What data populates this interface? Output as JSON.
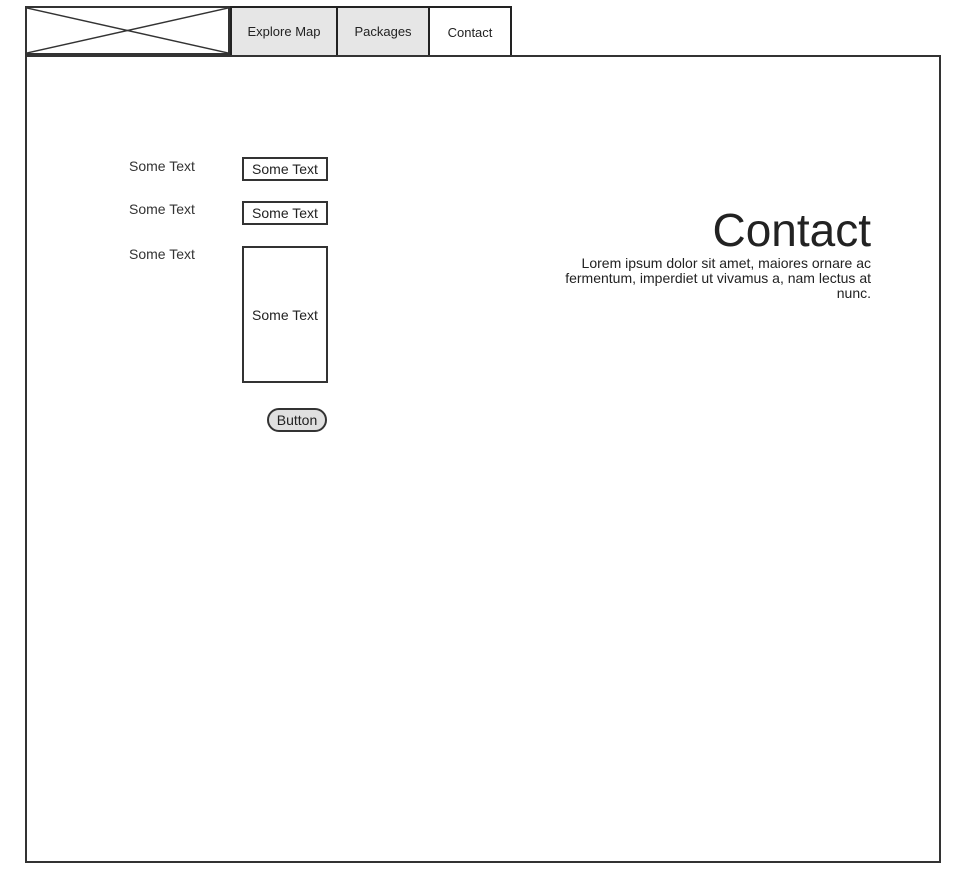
{
  "nav": {
    "tabs": [
      {
        "label": "Explore Map",
        "active": false
      },
      {
        "label": "Packages",
        "active": false
      },
      {
        "label": "Contact",
        "active": true
      }
    ]
  },
  "form": {
    "rows": [
      {
        "label": "Some Text",
        "value": "Some Text"
      },
      {
        "label": "Some Text",
        "value": "Some Text"
      },
      {
        "label": "Some Text",
        "value": "Some Text"
      }
    ],
    "button_label": "Button"
  },
  "contact": {
    "title": "Contact",
    "description": "Lorem ipsum dolor sit amet, maiores ornare ac fermentum, imperdiet ut vivamus a, nam lectus at nunc."
  },
  "colors": {
    "border": "#333333",
    "tab_inactive": "#e6e6e6",
    "tab_active": "#ffffff",
    "button_fill": "#e0e0e0"
  },
  "icons": {
    "logo": "image-placeholder-icon"
  }
}
